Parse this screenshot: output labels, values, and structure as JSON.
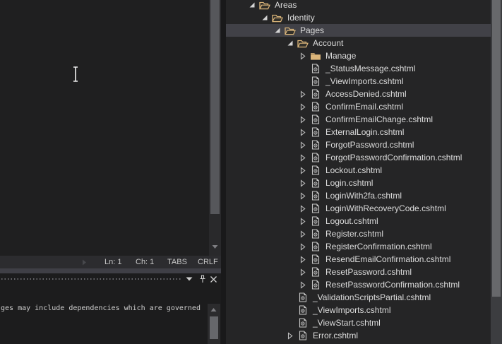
{
  "colors": {
    "editor_bg": "#1f1f20",
    "tree_bg": "#252526",
    "selection_bg": "#414147",
    "folder_accent": "#dcb67a",
    "text": "#dcdcdc",
    "statusbar_bg": "#2c2c2f",
    "window_border": "#3f3f46",
    "output_bg": "#1c1c1d"
  },
  "icons": {
    "chevron_expanded": "◢",
    "chevron_collapsed": "▷",
    "folder_open": "open-folder",
    "folder_closed": "closed-folder",
    "razor_file": "document-with-@",
    "window_menu": "▾",
    "pin": "pushpin-vertical",
    "close": "✕",
    "scroll_up": "▲",
    "scroll_down": "▼",
    "scroll_right": "▶",
    "mouse_cursor": "I-beam"
  },
  "editor": {
    "status_bar": {
      "line": "Ln: 1",
      "column": "Ch: 1",
      "indent_mode": "TABS",
      "line_ending": "CRLF"
    }
  },
  "output_panel": {
    "console_text": "ges may include dependencies which are governed"
  },
  "solution_explorer": {
    "rows": [
      {
        "label": "Areas",
        "level": 0,
        "chevron": "expanded",
        "icon": "folder-open",
        "selected": false
      },
      {
        "label": "Identity",
        "level": 1,
        "chevron": "expanded",
        "icon": "folder-open",
        "selected": false
      },
      {
        "label": "Pages",
        "level": 2,
        "chevron": "expanded",
        "icon": "folder-open",
        "selected": true
      },
      {
        "label": "Account",
        "level": 3,
        "chevron": "expanded",
        "icon": "folder-open",
        "selected": false
      },
      {
        "label": "Manage",
        "level": 4,
        "chevron": "collapsed",
        "icon": "folder-closed",
        "selected": false
      },
      {
        "label": "_StatusMessage.cshtml",
        "level": 4,
        "chevron": "none",
        "icon": "razor-file",
        "selected": false
      },
      {
        "label": "_ViewImports.cshtml",
        "level": 4,
        "chevron": "none",
        "icon": "razor-file",
        "selected": false
      },
      {
        "label": "AccessDenied.cshtml",
        "level": 4,
        "chevron": "collapsed",
        "icon": "razor-file",
        "selected": false
      },
      {
        "label": "ConfirmEmail.cshtml",
        "level": 4,
        "chevron": "collapsed",
        "icon": "razor-file",
        "selected": false
      },
      {
        "label": "ConfirmEmailChange.cshtml",
        "level": 4,
        "chevron": "collapsed",
        "icon": "razor-file",
        "selected": false
      },
      {
        "label": "ExternalLogin.cshtml",
        "level": 4,
        "chevron": "collapsed",
        "icon": "razor-file",
        "selected": false
      },
      {
        "label": "ForgotPassword.cshtml",
        "level": 4,
        "chevron": "collapsed",
        "icon": "razor-file",
        "selected": false
      },
      {
        "label": "ForgotPasswordConfirmation.cshtml",
        "level": 4,
        "chevron": "collapsed",
        "icon": "razor-file",
        "selected": false
      },
      {
        "label": "Lockout.cshtml",
        "level": 4,
        "chevron": "collapsed",
        "icon": "razor-file",
        "selected": false
      },
      {
        "label": "Login.cshtml",
        "level": 4,
        "chevron": "collapsed",
        "icon": "razor-file",
        "selected": false
      },
      {
        "label": "LoginWith2fa.cshtml",
        "level": 4,
        "chevron": "collapsed",
        "icon": "razor-file",
        "selected": false
      },
      {
        "label": "LoginWithRecoveryCode.cshtml",
        "level": 4,
        "chevron": "collapsed",
        "icon": "razor-file",
        "selected": false
      },
      {
        "label": "Logout.cshtml",
        "level": 4,
        "chevron": "collapsed",
        "icon": "razor-file",
        "selected": false
      },
      {
        "label": "Register.cshtml",
        "level": 4,
        "chevron": "collapsed",
        "icon": "razor-file",
        "selected": false
      },
      {
        "label": "RegisterConfirmation.cshtml",
        "level": 4,
        "chevron": "collapsed",
        "icon": "razor-file",
        "selected": false
      },
      {
        "label": "ResendEmailConfirmation.cshtml",
        "level": 4,
        "chevron": "collapsed",
        "icon": "razor-file",
        "selected": false
      },
      {
        "label": "ResetPassword.cshtml",
        "level": 4,
        "chevron": "collapsed",
        "icon": "razor-file",
        "selected": false
      },
      {
        "label": "ResetPasswordConfirmation.cshtml",
        "level": 4,
        "chevron": "collapsed",
        "icon": "razor-file",
        "selected": false
      },
      {
        "label": "_ValidationScriptsPartial.cshtml",
        "level": 3,
        "chevron": "none",
        "icon": "razor-file",
        "selected": false
      },
      {
        "label": "_ViewImports.cshtml",
        "level": 3,
        "chevron": "none",
        "icon": "razor-file",
        "selected": false
      },
      {
        "label": "_ViewStart.cshtml",
        "level": 3,
        "chevron": "none",
        "icon": "razor-file",
        "selected": false
      },
      {
        "label": "Error.cshtml",
        "level": 3,
        "chevron": "collapsed",
        "icon": "razor-file",
        "selected": false
      }
    ]
  }
}
